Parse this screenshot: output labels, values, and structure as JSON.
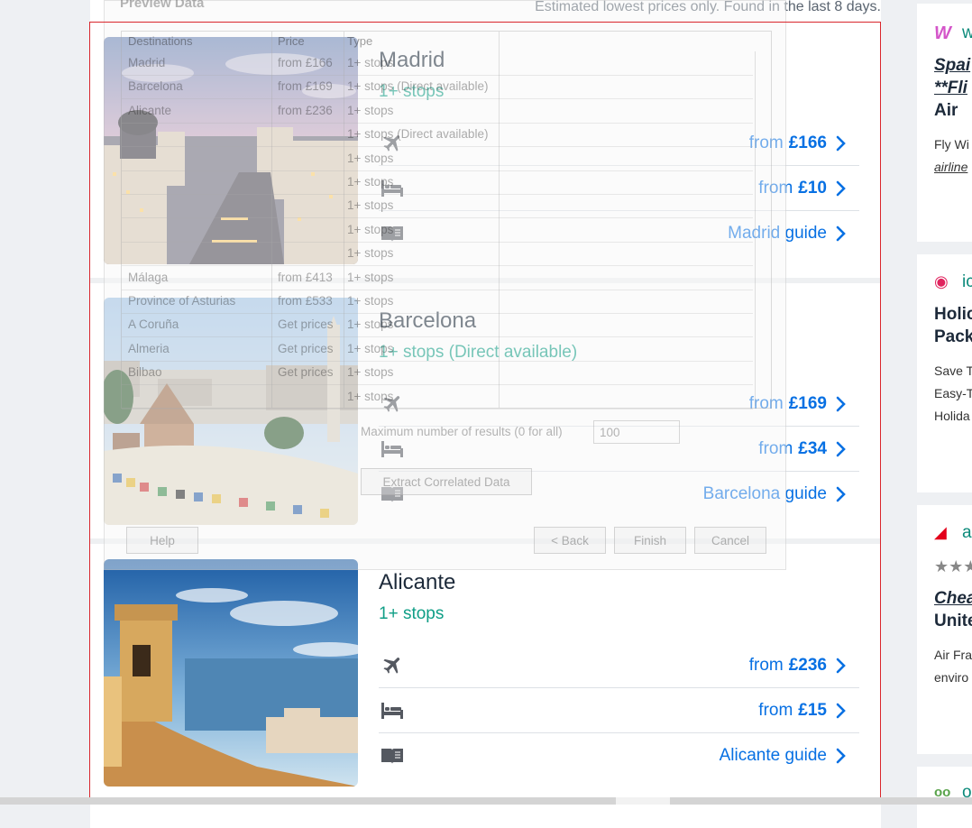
{
  "header": {
    "note": "Estimated lowest prices only. Found in the last 8 days."
  },
  "destinations": [
    {
      "city": "Madrid",
      "stops": "1+ stops",
      "flight_prefix": "from",
      "flight_price": "£166",
      "hotel_prefix": "from",
      "hotel_price": "£10",
      "guide": "Madrid guide",
      "photo": "madrid-cityscape"
    },
    {
      "city": "Barcelona",
      "stops": "1+ stops (Direct available)",
      "flight_prefix": "from",
      "flight_price": "£169",
      "hotel_prefix": "from",
      "hotel_price": "£34",
      "guide": "Barcelona guide",
      "photo": "park-guell-mosaic"
    },
    {
      "city": "Alicante",
      "stops": "1+ stops",
      "flight_prefix": "from",
      "flight_price": "£236",
      "hotel_prefix": "from",
      "hotel_price": "£15",
      "guide": "Alicante guide",
      "photo": "alicante-castle-coast"
    }
  ],
  "icons": {
    "flight": "plane-icon",
    "hotel": "bed-icon",
    "guide": "book-icon",
    "more": "chevron-right-icon"
  },
  "sidebar_ads": [
    {
      "logo": "W",
      "brand": "w",
      "title1": "Spai",
      "title2": "**Fli",
      "title3": "Air",
      "body1": "Fly Wi",
      "body2": "airline",
      "logo_color": "#d455c9"
    },
    {
      "logo": "◉",
      "brand": "ic",
      "title1": "Holic",
      "title2": "Pack",
      "body1": "Save T",
      "body2": "Easy-T",
      "body3": "Holida",
      "logo_color": "#e0245e"
    },
    {
      "logo": "◢",
      "brand": "a",
      "rating": "★★★",
      "title1": "Chea",
      "title2": "Unite",
      "body1": "Air Fra",
      "body2": "enviro",
      "logo_color": "#e3001b"
    },
    {
      "logo": "oo",
      "brand": "o",
      "logo_color": "#59a34b"
    }
  ],
  "dialog": {
    "title": "Preview Data",
    "columns": [
      "Destinations",
      "Price",
      "Type"
    ],
    "rows": [
      [
        "Madrid",
        "from £166",
        "1+ stops"
      ],
      [
        "Barcelona",
        "from £169",
        "1+ stops (Direct available)"
      ],
      [
        "Alicante",
        "from £236",
        "1+ stops"
      ],
      [
        "",
        "",
        "1+ stops (Direct available)"
      ],
      [
        "",
        "",
        "1+ stops"
      ],
      [
        "",
        "",
        "1+ stops"
      ],
      [
        "",
        "",
        "1+ stops"
      ],
      [
        "",
        "",
        "1+ stops"
      ],
      [
        "",
        "",
        "1+ stops"
      ],
      [
        "Málaga",
        "from £413",
        "1+ stops"
      ],
      [
        "Province of Asturias",
        "from £533",
        "1+ stops"
      ],
      [
        "A Coruña",
        "Get prices",
        "1+ stops"
      ],
      [
        "Almeria",
        "Get prices",
        "1+ stops"
      ],
      [
        "Bilbao",
        "Get prices",
        "1+ stops"
      ],
      [
        "",
        "",
        "1+ stops"
      ]
    ],
    "max_label": "Maximum number of results (0 for all)",
    "max_value": "100",
    "extract_label": "Extract Correlated Data",
    "help_label": "Help",
    "back_label": "< Back",
    "finish_label": "Finish",
    "cancel_label": "Cancel"
  },
  "colors": {
    "link": "#0770e3",
    "stops": "#0f9e86",
    "highlight_border": "#d9262c"
  }
}
